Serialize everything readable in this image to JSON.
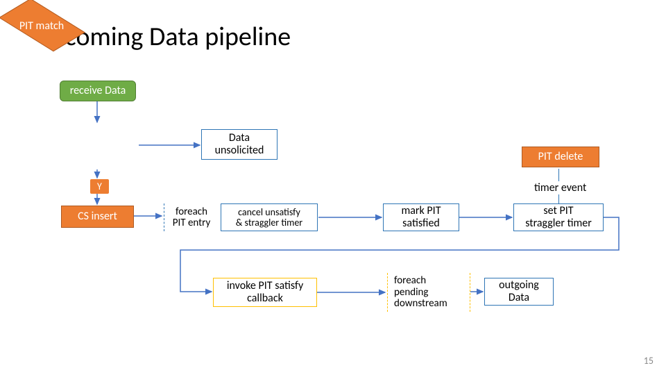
{
  "title": "incoming Data pipeline",
  "nodes": {
    "receive": "receive Data",
    "pit_match": "PIT match",
    "y_label": "Y",
    "unsolicited": "Data\nunsolicited",
    "cs_insert": "CS insert",
    "foreach1": "foreach\nPIT entry",
    "cancel": "cancel unsatisfy\n& straggler timer",
    "mark_pit": "mark PIT\nsatisfied",
    "set_pit": "set PIT\nstraggler timer",
    "pit_delete": "PIT delete",
    "timer_event": "timer event",
    "invoke": "invoke PIT satisfy\ncallback",
    "foreach2": "foreach\npending\ndownstream",
    "outgoing": "outgoing\nData"
  },
  "page": "15"
}
